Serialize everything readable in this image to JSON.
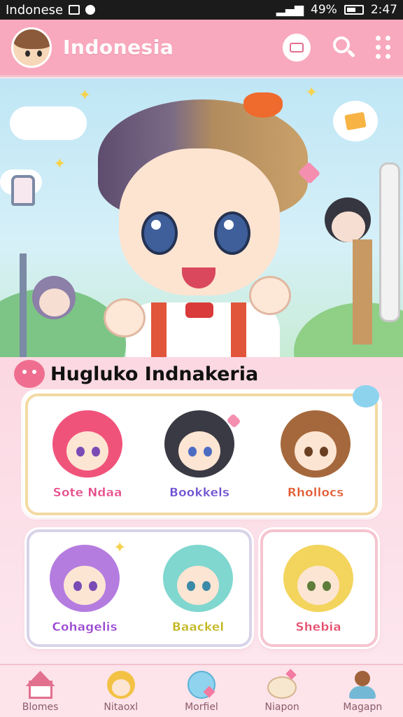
{
  "status_bar": {
    "carrier": "Indonese",
    "battery": "49%",
    "time": "2:47"
  },
  "app_bar": {
    "title": "Indonesia"
  },
  "section": {
    "title": "Hugluko Indnakeria"
  },
  "characters_top": [
    {
      "name": "Sote Ndaa",
      "hair": "#f0537a"
    },
    {
      "name": "Bookkels",
      "hair": "#3a3a44"
    },
    {
      "name": "Rhollocs",
      "hair": "#a5683c"
    }
  ],
  "characters_bottom": [
    {
      "name": "Cohagelis",
      "hair": "#b57ce0"
    },
    {
      "name": "Baackel",
      "hair": "#7fd7cf"
    },
    {
      "name": "Shebia",
      "hair": "#f3d45c"
    }
  ],
  "bottom_nav": [
    {
      "label": "Blomes",
      "icon": "house-icon"
    },
    {
      "label": "Nitaoxl",
      "icon": "chibi-avatar-icon"
    },
    {
      "label": "Morfiel",
      "icon": "bubble-heart-icon"
    },
    {
      "label": "Niapon",
      "icon": "bear-mascot-icon"
    },
    {
      "label": "Magapn",
      "icon": "profile-avatar-icon"
    }
  ],
  "colors": {
    "brand_pink": "#f8a9bd",
    "label_pink": "#e64a8a",
    "background": "#fde3ea"
  }
}
